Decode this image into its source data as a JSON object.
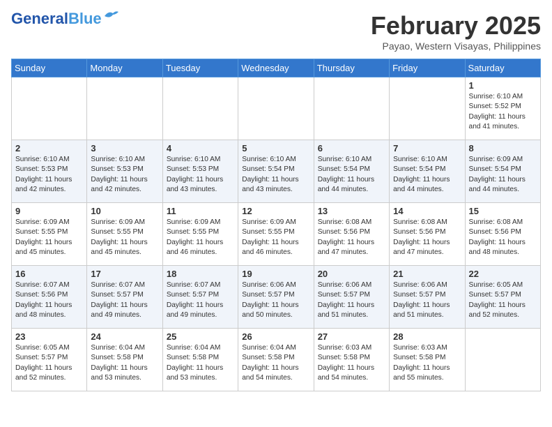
{
  "header": {
    "logo_line1": "General",
    "logo_line2": "Blue",
    "month_title": "February 2025",
    "subtitle": "Payao, Western Visayas, Philippines"
  },
  "days_of_week": [
    "Sunday",
    "Monday",
    "Tuesday",
    "Wednesday",
    "Thursday",
    "Friday",
    "Saturday"
  ],
  "weeks": [
    {
      "days": [
        {
          "num": "",
          "info": ""
        },
        {
          "num": "",
          "info": ""
        },
        {
          "num": "",
          "info": ""
        },
        {
          "num": "",
          "info": ""
        },
        {
          "num": "",
          "info": ""
        },
        {
          "num": "",
          "info": ""
        },
        {
          "num": "1",
          "info": "Sunrise: 6:10 AM\nSunset: 5:52 PM\nDaylight: 11 hours\nand 41 minutes."
        }
      ]
    },
    {
      "days": [
        {
          "num": "2",
          "info": "Sunrise: 6:10 AM\nSunset: 5:53 PM\nDaylight: 11 hours\nand 42 minutes."
        },
        {
          "num": "3",
          "info": "Sunrise: 6:10 AM\nSunset: 5:53 PM\nDaylight: 11 hours\nand 42 minutes."
        },
        {
          "num": "4",
          "info": "Sunrise: 6:10 AM\nSunset: 5:53 PM\nDaylight: 11 hours\nand 43 minutes."
        },
        {
          "num": "5",
          "info": "Sunrise: 6:10 AM\nSunset: 5:54 PM\nDaylight: 11 hours\nand 43 minutes."
        },
        {
          "num": "6",
          "info": "Sunrise: 6:10 AM\nSunset: 5:54 PM\nDaylight: 11 hours\nand 44 minutes."
        },
        {
          "num": "7",
          "info": "Sunrise: 6:10 AM\nSunset: 5:54 PM\nDaylight: 11 hours\nand 44 minutes."
        },
        {
          "num": "8",
          "info": "Sunrise: 6:09 AM\nSunset: 5:54 PM\nDaylight: 11 hours\nand 44 minutes."
        }
      ]
    },
    {
      "days": [
        {
          "num": "9",
          "info": "Sunrise: 6:09 AM\nSunset: 5:55 PM\nDaylight: 11 hours\nand 45 minutes."
        },
        {
          "num": "10",
          "info": "Sunrise: 6:09 AM\nSunset: 5:55 PM\nDaylight: 11 hours\nand 45 minutes."
        },
        {
          "num": "11",
          "info": "Sunrise: 6:09 AM\nSunset: 5:55 PM\nDaylight: 11 hours\nand 46 minutes."
        },
        {
          "num": "12",
          "info": "Sunrise: 6:09 AM\nSunset: 5:55 PM\nDaylight: 11 hours\nand 46 minutes."
        },
        {
          "num": "13",
          "info": "Sunrise: 6:08 AM\nSunset: 5:56 PM\nDaylight: 11 hours\nand 47 minutes."
        },
        {
          "num": "14",
          "info": "Sunrise: 6:08 AM\nSunset: 5:56 PM\nDaylight: 11 hours\nand 47 minutes."
        },
        {
          "num": "15",
          "info": "Sunrise: 6:08 AM\nSunset: 5:56 PM\nDaylight: 11 hours\nand 48 minutes."
        }
      ]
    },
    {
      "days": [
        {
          "num": "16",
          "info": "Sunrise: 6:07 AM\nSunset: 5:56 PM\nDaylight: 11 hours\nand 48 minutes."
        },
        {
          "num": "17",
          "info": "Sunrise: 6:07 AM\nSunset: 5:57 PM\nDaylight: 11 hours\nand 49 minutes."
        },
        {
          "num": "18",
          "info": "Sunrise: 6:07 AM\nSunset: 5:57 PM\nDaylight: 11 hours\nand 49 minutes."
        },
        {
          "num": "19",
          "info": "Sunrise: 6:06 AM\nSunset: 5:57 PM\nDaylight: 11 hours\nand 50 minutes."
        },
        {
          "num": "20",
          "info": "Sunrise: 6:06 AM\nSunset: 5:57 PM\nDaylight: 11 hours\nand 51 minutes."
        },
        {
          "num": "21",
          "info": "Sunrise: 6:06 AM\nSunset: 5:57 PM\nDaylight: 11 hours\nand 51 minutes."
        },
        {
          "num": "22",
          "info": "Sunrise: 6:05 AM\nSunset: 5:57 PM\nDaylight: 11 hours\nand 52 minutes."
        }
      ]
    },
    {
      "days": [
        {
          "num": "23",
          "info": "Sunrise: 6:05 AM\nSunset: 5:57 PM\nDaylight: 11 hours\nand 52 minutes."
        },
        {
          "num": "24",
          "info": "Sunrise: 6:04 AM\nSunset: 5:58 PM\nDaylight: 11 hours\nand 53 minutes."
        },
        {
          "num": "25",
          "info": "Sunrise: 6:04 AM\nSunset: 5:58 PM\nDaylight: 11 hours\nand 53 minutes."
        },
        {
          "num": "26",
          "info": "Sunrise: 6:04 AM\nSunset: 5:58 PM\nDaylight: 11 hours\nand 54 minutes."
        },
        {
          "num": "27",
          "info": "Sunrise: 6:03 AM\nSunset: 5:58 PM\nDaylight: 11 hours\nand 54 minutes."
        },
        {
          "num": "28",
          "info": "Sunrise: 6:03 AM\nSunset: 5:58 PM\nDaylight: 11 hours\nand 55 minutes."
        },
        {
          "num": "",
          "info": ""
        }
      ]
    }
  ]
}
